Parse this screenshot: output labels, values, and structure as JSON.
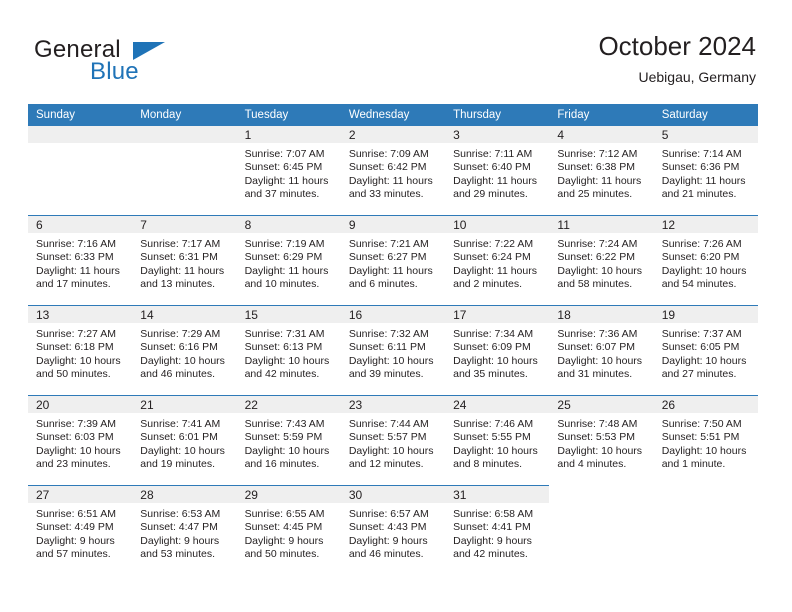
{
  "brand": {
    "word1": "General",
    "word2": "Blue",
    "triangle_icon": "brand-triangle-icon",
    "accent_color": "#1f73b7"
  },
  "header": {
    "title": "October 2024",
    "subtitle": "Uebigau, Germany"
  },
  "colors": {
    "header_row": "#2e7ab8",
    "daynum_band": "#efefef",
    "text": "#231f20"
  },
  "weekday_headers": [
    "Sunday",
    "Monday",
    "Tuesday",
    "Wednesday",
    "Thursday",
    "Friday",
    "Saturday"
  ],
  "weeks": [
    [
      {
        "day": "",
        "lines": []
      },
      {
        "day": "",
        "lines": []
      },
      {
        "day": "1",
        "lines": [
          "Sunrise: 7:07 AM",
          "Sunset: 6:45 PM",
          "Daylight: 11 hours and 37 minutes."
        ]
      },
      {
        "day": "2",
        "lines": [
          "Sunrise: 7:09 AM",
          "Sunset: 6:42 PM",
          "Daylight: 11 hours and 33 minutes."
        ]
      },
      {
        "day": "3",
        "lines": [
          "Sunrise: 7:11 AM",
          "Sunset: 6:40 PM",
          "Daylight: 11 hours and 29 minutes."
        ]
      },
      {
        "day": "4",
        "lines": [
          "Sunrise: 7:12 AM",
          "Sunset: 6:38 PM",
          "Daylight: 11 hours and 25 minutes."
        ]
      },
      {
        "day": "5",
        "lines": [
          "Sunrise: 7:14 AM",
          "Sunset: 6:36 PM",
          "Daylight: 11 hours and 21 minutes."
        ]
      }
    ],
    [
      {
        "day": "6",
        "lines": [
          "Sunrise: 7:16 AM",
          "Sunset: 6:33 PM",
          "Daylight: 11 hours and 17 minutes."
        ]
      },
      {
        "day": "7",
        "lines": [
          "Sunrise: 7:17 AM",
          "Sunset: 6:31 PM",
          "Daylight: 11 hours and 13 minutes."
        ]
      },
      {
        "day": "8",
        "lines": [
          "Sunrise: 7:19 AM",
          "Sunset: 6:29 PM",
          "Daylight: 11 hours and 10 minutes."
        ]
      },
      {
        "day": "9",
        "lines": [
          "Sunrise: 7:21 AM",
          "Sunset: 6:27 PM",
          "Daylight: 11 hours and 6 minutes."
        ]
      },
      {
        "day": "10",
        "lines": [
          "Sunrise: 7:22 AM",
          "Sunset: 6:24 PM",
          "Daylight: 11 hours and 2 minutes."
        ]
      },
      {
        "day": "11",
        "lines": [
          "Sunrise: 7:24 AM",
          "Sunset: 6:22 PM",
          "Daylight: 10 hours and 58 minutes."
        ]
      },
      {
        "day": "12",
        "lines": [
          "Sunrise: 7:26 AM",
          "Sunset: 6:20 PM",
          "Daylight: 10 hours and 54 minutes."
        ]
      }
    ],
    [
      {
        "day": "13",
        "lines": [
          "Sunrise: 7:27 AM",
          "Sunset: 6:18 PM",
          "Daylight: 10 hours and 50 minutes."
        ]
      },
      {
        "day": "14",
        "lines": [
          "Sunrise: 7:29 AM",
          "Sunset: 6:16 PM",
          "Daylight: 10 hours and 46 minutes."
        ]
      },
      {
        "day": "15",
        "lines": [
          "Sunrise: 7:31 AM",
          "Sunset: 6:13 PM",
          "Daylight: 10 hours and 42 minutes."
        ]
      },
      {
        "day": "16",
        "lines": [
          "Sunrise: 7:32 AM",
          "Sunset: 6:11 PM",
          "Daylight: 10 hours and 39 minutes."
        ]
      },
      {
        "day": "17",
        "lines": [
          "Sunrise: 7:34 AM",
          "Sunset: 6:09 PM",
          "Daylight: 10 hours and 35 minutes."
        ]
      },
      {
        "day": "18",
        "lines": [
          "Sunrise: 7:36 AM",
          "Sunset: 6:07 PM",
          "Daylight: 10 hours and 31 minutes."
        ]
      },
      {
        "day": "19",
        "lines": [
          "Sunrise: 7:37 AM",
          "Sunset: 6:05 PM",
          "Daylight: 10 hours and 27 minutes."
        ]
      }
    ],
    [
      {
        "day": "20",
        "lines": [
          "Sunrise: 7:39 AM",
          "Sunset: 6:03 PM",
          "Daylight: 10 hours and 23 minutes."
        ]
      },
      {
        "day": "21",
        "lines": [
          "Sunrise: 7:41 AM",
          "Sunset: 6:01 PM",
          "Daylight: 10 hours and 19 minutes."
        ]
      },
      {
        "day": "22",
        "lines": [
          "Sunrise: 7:43 AM",
          "Sunset: 5:59 PM",
          "Daylight: 10 hours and 16 minutes."
        ]
      },
      {
        "day": "23",
        "lines": [
          "Sunrise: 7:44 AM",
          "Sunset: 5:57 PM",
          "Daylight: 10 hours and 12 minutes."
        ]
      },
      {
        "day": "24",
        "lines": [
          "Sunrise: 7:46 AM",
          "Sunset: 5:55 PM",
          "Daylight: 10 hours and 8 minutes."
        ]
      },
      {
        "day": "25",
        "lines": [
          "Sunrise: 7:48 AM",
          "Sunset: 5:53 PM",
          "Daylight: 10 hours and 4 minutes."
        ]
      },
      {
        "day": "26",
        "lines": [
          "Sunrise: 7:50 AM",
          "Sunset: 5:51 PM",
          "Daylight: 10 hours and 1 minute."
        ]
      }
    ],
    [
      {
        "day": "27",
        "lines": [
          "Sunrise: 6:51 AM",
          "Sunset: 4:49 PM",
          "Daylight: 9 hours and 57 minutes."
        ]
      },
      {
        "day": "28",
        "lines": [
          "Sunrise: 6:53 AM",
          "Sunset: 4:47 PM",
          "Daylight: 9 hours and 53 minutes."
        ]
      },
      {
        "day": "29",
        "lines": [
          "Sunrise: 6:55 AM",
          "Sunset: 4:45 PM",
          "Daylight: 9 hours and 50 minutes."
        ]
      },
      {
        "day": "30",
        "lines": [
          "Sunrise: 6:57 AM",
          "Sunset: 4:43 PM",
          "Daylight: 9 hours and 46 minutes."
        ]
      },
      {
        "day": "31",
        "lines": [
          "Sunrise: 6:58 AM",
          "Sunset: 4:41 PM",
          "Daylight: 9 hours and 42 minutes."
        ]
      },
      {
        "day": "",
        "lines": []
      },
      {
        "day": "",
        "lines": []
      }
    ]
  ]
}
